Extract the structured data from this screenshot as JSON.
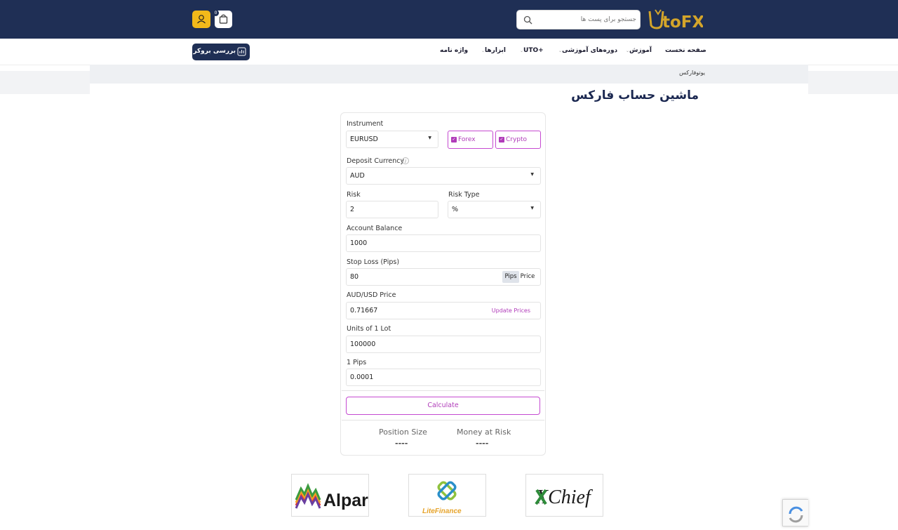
{
  "header": {
    "logo_text": "UtoFX",
    "search_placeholder": "جستجو برای پست ها",
    "cart_count": "0"
  },
  "nav": {
    "items": [
      {
        "label": "صفحه نخست"
      },
      {
        "label": "آموزش"
      },
      {
        "label": "دوره‌های آموزشی"
      },
      {
        "label": "UTO+"
      },
      {
        "label": "ابزارها"
      },
      {
        "label": "واژه نامه"
      }
    ],
    "broker_button": "بررسی بروکر ها"
  },
  "breadcrumb": "یوتوفارکس",
  "page_title": "ماشین حساب فارکس",
  "calculator": {
    "instrument_label": "Instrument",
    "instrument_value": "EURUSD",
    "forex_label": "Forex",
    "crypto_label": "Crypto",
    "deposit_currency_label": "Deposit Currency",
    "deposit_currency_value": "AUD",
    "risk_label": "Risk",
    "risk_value": "2",
    "risk_type_label": "Risk Type",
    "risk_type_value": "%",
    "account_balance_label": "Account Balance",
    "account_balance_value": "1000",
    "stop_loss_label": "Stop Loss (Pips)",
    "stop_loss_value": "80",
    "pips_tab": "Pips",
    "price_tab": "Price",
    "price_label": "AUD/USD Price",
    "price_value": "0.71667",
    "update_prices": "Update Prices",
    "units_label": "Units of 1 Lot",
    "units_value": "100000",
    "pips_label": "1 Pips",
    "pips_value": "0.0001",
    "calculate_button": "Calculate",
    "position_size_label": "Position Size",
    "position_size_value": "----",
    "money_at_risk_label": "Money at Risk",
    "money_at_risk_value": "----"
  },
  "brokers": [
    {
      "name": "Alpari"
    },
    {
      "name": "LiteFinance"
    },
    {
      "name": "XChief"
    }
  ],
  "colors": {
    "header_bg": "#1f2f55",
    "accent": "#b03bb9",
    "user_button": "#f2b91a",
    "title": "#1a2750"
  }
}
